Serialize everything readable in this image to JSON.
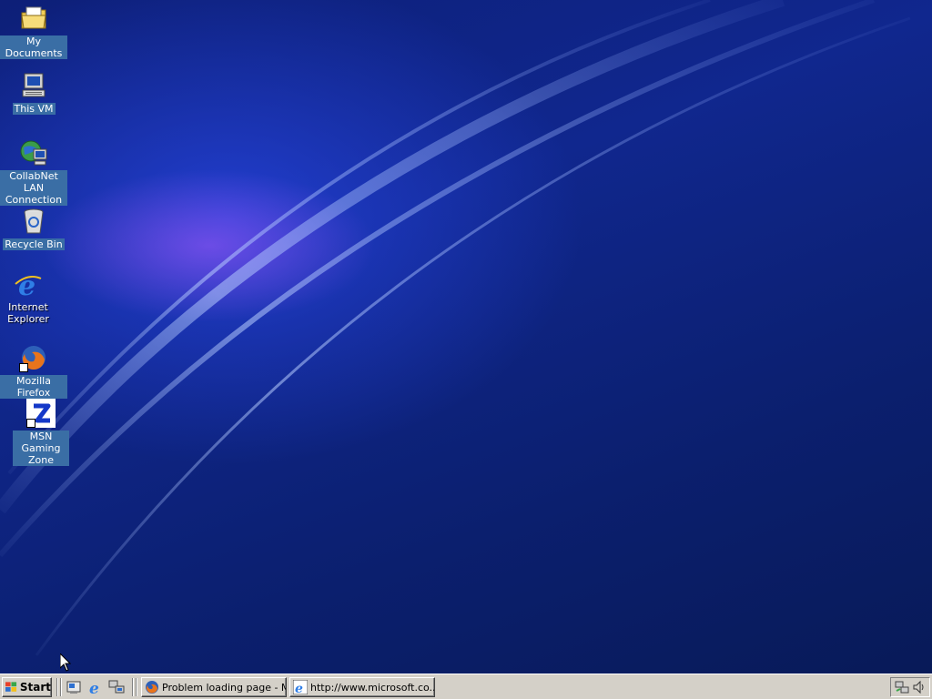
{
  "desktop": {
    "icons": [
      {
        "label": "My Documents",
        "icon": "folder-documents-icon",
        "selected": true
      },
      {
        "label": "This VM",
        "icon": "computer-icon",
        "selected": true
      },
      {
        "label": "CollabNet LAN Connection",
        "icon": "network-connection-icon",
        "selected": true
      },
      {
        "label": "Recycle Bin",
        "icon": "recycle-bin-icon",
        "selected": true
      },
      {
        "label": "Internet Explorer",
        "icon": "internet-explorer-icon",
        "selected": false
      },
      {
        "label": "Mozilla Firefox",
        "icon": "firefox-icon",
        "selected": true
      },
      {
        "label": "MSN Gaming Zone",
        "icon": "msn-gaming-zone-icon",
        "selected": true
      }
    ]
  },
  "taskbar": {
    "start_label": "Start",
    "quick_launch": [
      {
        "icon": "show-desktop-icon"
      },
      {
        "icon": "internet-explorer-icon"
      },
      {
        "icon": "network-icon"
      }
    ],
    "tasks": [
      {
        "label": "Problem loading page - M...",
        "icon": "firefox-icon"
      },
      {
        "label": "http://www.microsoft.co...",
        "icon": "internet-explorer-icon"
      }
    ],
    "tray": [
      {
        "icon": "network-tray-icon"
      },
      {
        "icon": "volume-icon"
      }
    ]
  },
  "colors": {
    "desktop_bg": "#0d1f78",
    "selection": "#3a6ea5",
    "taskbar": "#d4d0c8"
  }
}
